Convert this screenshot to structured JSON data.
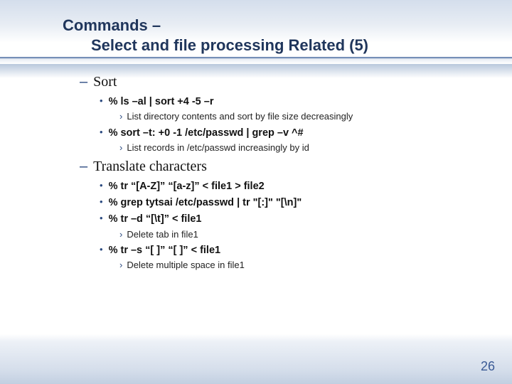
{
  "title": {
    "line1": "Commands –",
    "line2": "Select and file processing Related (5)"
  },
  "sections": [
    {
      "heading": "Sort",
      "items": [
        {
          "cmd": "% ls –al | sort +4 -5 –r",
          "subs": [
            "List directory contents and sort by file size decreasingly"
          ]
        },
        {
          "cmd": "% sort –t: +0 -1 /etc/passwd | grep –v ^#",
          "subs": [
            "List records in /etc/passwd increasingly by id"
          ]
        }
      ]
    },
    {
      "heading": "Translate characters",
      "items": [
        {
          "cmd": "% tr “[A-Z]” “[a-z]” < file1 > file2",
          "subs": []
        },
        {
          "cmd": "% grep tytsai /etc/passwd | tr \"[:]\" \"[\\n]\"",
          "subs": []
        },
        {
          "cmd": "% tr –d “[\\t]” < file1",
          "subs": [
            "Delete tab in file1"
          ]
        },
        {
          "cmd": "% tr –s “[ ]” “[ ]” < file1",
          "subs": [
            "Delete multiple space in file1"
          ]
        }
      ]
    }
  ],
  "pagenum": "26",
  "glyphs": {
    "dash": "–",
    "dot": "•",
    "chev": "›"
  }
}
